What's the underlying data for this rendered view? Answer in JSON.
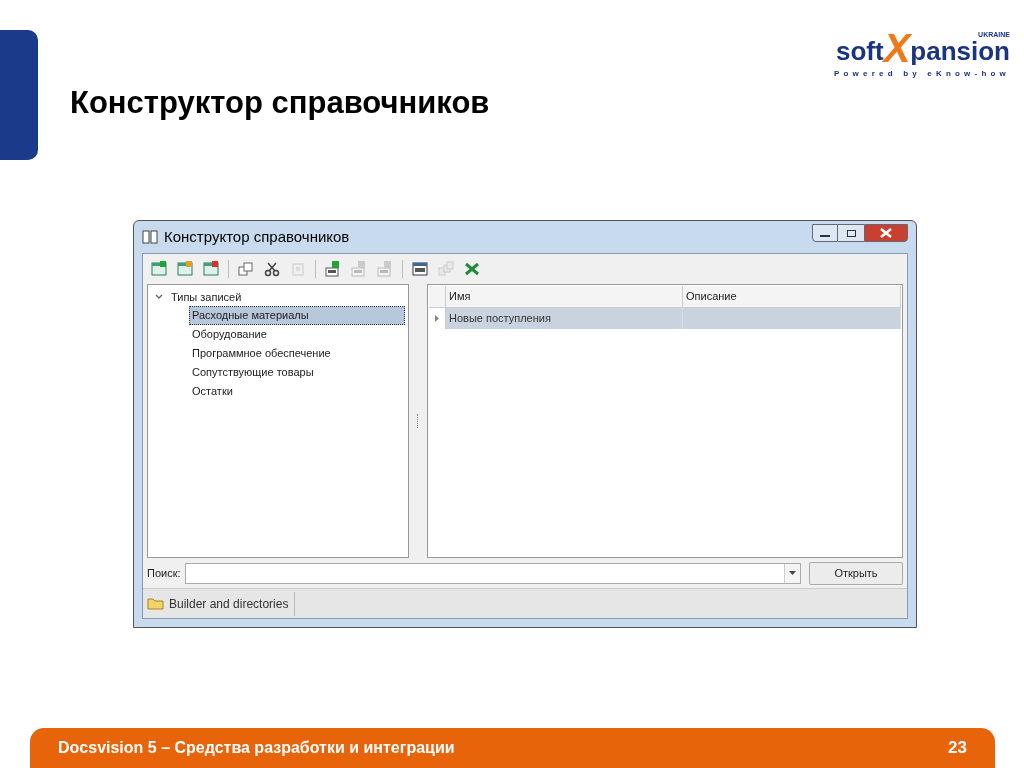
{
  "slide": {
    "title": "Конструктор справочников",
    "logo": {
      "soft": "soft",
      "x": "X",
      "pansion": "pansion",
      "region": "UKRAINE",
      "tagline": "Powered by eKnow-how"
    },
    "footer": {
      "text": "Docsvision 5 – Средства разработки и интеграции",
      "page": "23"
    }
  },
  "window": {
    "title": "Конструктор справочников",
    "toolbar": [
      [
        {
          "disabled": false
        },
        {
          "disabled": false
        },
        {
          "disabled": false
        }
      ],
      [
        {
          "disabled": false
        },
        {
          "disabled": false
        },
        {
          "disabled": true
        }
      ],
      [
        {
          "disabled": false
        },
        {
          "disabled": true
        },
        {
          "disabled": true
        }
      ],
      [
        {
          "disabled": false
        },
        {
          "disabled": true
        },
        {
          "disabled": false
        }
      ]
    ],
    "tree": {
      "label": "Типы записей",
      "expanded": true,
      "children": [
        {
          "label": "Расходные материалы",
          "selected": true
        },
        {
          "label": "Оборудование",
          "selected": false
        },
        {
          "label": "Программное обеспечение",
          "selected": false
        },
        {
          "label": "Сопутствующие товары",
          "selected": false
        },
        {
          "label": "Остатки",
          "selected": false
        }
      ]
    },
    "table": {
      "columns": [
        "Имя",
        "Описание"
      ],
      "rows": [
        {
          "cells": [
            "Новые поступления",
            ""
          ],
          "selected": true
        }
      ]
    },
    "search": {
      "label": "Поиск:",
      "button": "Открыть"
    },
    "status_bar": {
      "tab": "Builder and directories"
    }
  }
}
